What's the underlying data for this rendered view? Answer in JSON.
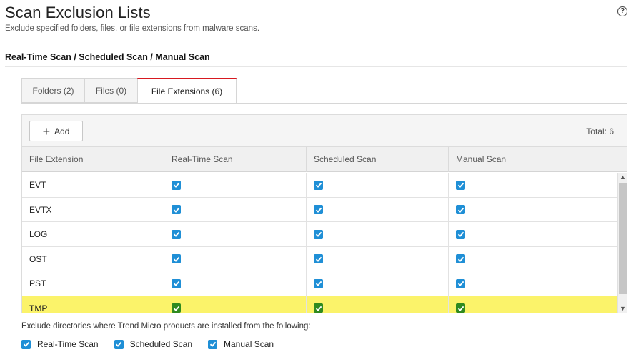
{
  "page": {
    "title": "Scan Exclusion Lists",
    "subtitle": "Exclude specified folders, files, or file extensions from malware scans.",
    "help_icon": "?"
  },
  "section": {
    "title": "Real-Time Scan / Scheduled Scan / Manual Scan"
  },
  "tabs": [
    {
      "label": "Folders (2)",
      "active": false
    },
    {
      "label": "Files (0)",
      "active": false
    },
    {
      "label": "File Extensions (6)",
      "active": true
    }
  ],
  "toolbar": {
    "add_label": "Add",
    "total_label": "Total: 6"
  },
  "table": {
    "columns": [
      "File Extension",
      "Real-Time Scan",
      "Scheduled Scan",
      "Manual Scan"
    ],
    "rows": [
      {
        "extension": "EVT",
        "realtime": true,
        "scheduled": true,
        "manual": true
      },
      {
        "extension": "EVTX",
        "realtime": true,
        "scheduled": true,
        "manual": true
      },
      {
        "extension": "LOG",
        "realtime": true,
        "scheduled": true,
        "manual": true
      },
      {
        "extension": "OST",
        "realtime": true,
        "scheduled": true,
        "manual": true
      },
      {
        "extension": "PST",
        "realtime": true,
        "scheduled": true,
        "manual": true
      },
      {
        "extension": "TMP",
        "realtime": true,
        "scheduled": true,
        "manual": true,
        "highlighted": true
      }
    ]
  },
  "footer": {
    "note": "Exclude directories where Trend Micro products are installed from the following:",
    "options": [
      {
        "label": "Real-Time Scan",
        "checked": true
      },
      {
        "label": "Scheduled Scan",
        "checked": true
      },
      {
        "label": "Manual Scan",
        "checked": true
      }
    ]
  },
  "colors": {
    "checkbox_blue": "#1f8fd6",
    "checkbox_green": "#2f8a1f",
    "highlight_yellow": "#fbf36a",
    "active_tab_accent": "#d71920"
  }
}
